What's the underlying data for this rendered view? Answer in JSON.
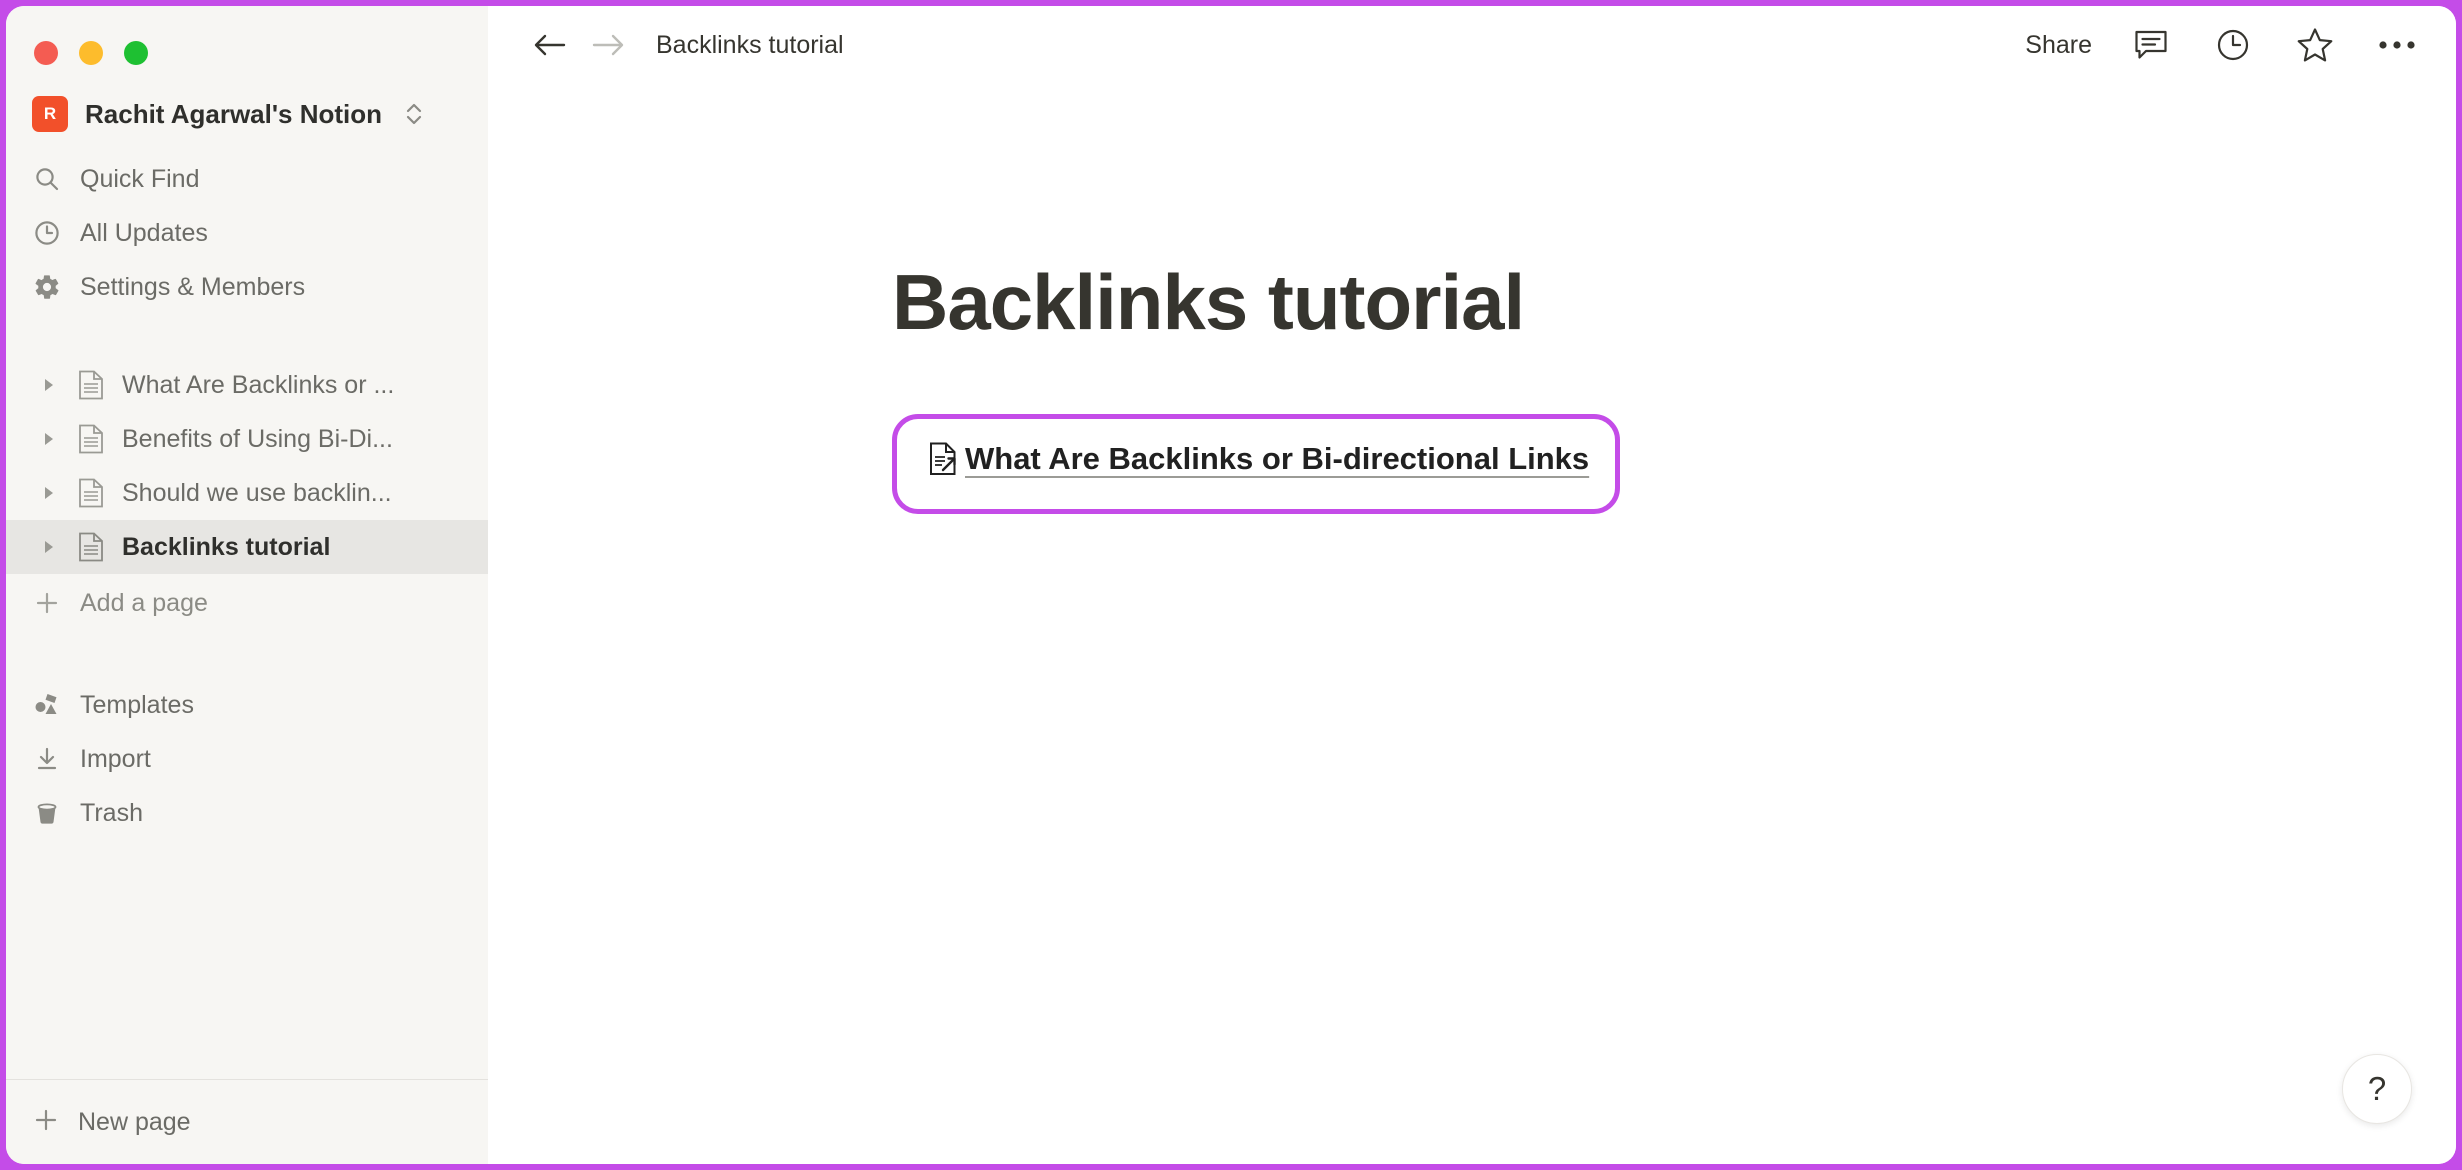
{
  "window": {
    "accent_border_color": "#c44ce8",
    "traffic_lights": [
      {
        "name": "close",
        "color": "#f45c52"
      },
      {
        "name": "minimize",
        "color": "#fdbc2c"
      },
      {
        "name": "maximize",
        "color": "#1ec032"
      }
    ]
  },
  "sidebar": {
    "workspace": {
      "avatar_letter": "R",
      "avatar_color": "#f2502a",
      "name": "Rachit Agarwal's Notion",
      "chevron_icon": "chevron-up-down-icon"
    },
    "nav_items": [
      {
        "icon": "search-icon",
        "label": "Quick Find"
      },
      {
        "icon": "clock-icon",
        "label": "All Updates"
      },
      {
        "icon": "gear-icon",
        "label": "Settings & Members"
      }
    ],
    "pages": [
      {
        "icon": "page-icon",
        "caret": "caret-right-icon",
        "label": "What Are Backlinks or ...",
        "selected": false
      },
      {
        "icon": "page-icon",
        "caret": "caret-right-icon",
        "label": "Benefits of Using Bi-Di...",
        "selected": false
      },
      {
        "icon": "page-icon",
        "caret": "caret-right-icon",
        "label": "Should we use backlin...",
        "selected": false
      },
      {
        "icon": "page-icon",
        "caret": "caret-right-icon",
        "label": "Backlinks tutorial",
        "selected": true
      }
    ],
    "add_page": {
      "icon": "plus-icon",
      "label": "Add a page"
    },
    "tools": [
      {
        "icon": "templates-icon",
        "label": "Templates"
      },
      {
        "icon": "import-icon",
        "label": "Import"
      },
      {
        "icon": "trash-icon",
        "label": "Trash"
      }
    ],
    "new_page": {
      "icon": "plus-icon",
      "label": "New page"
    }
  },
  "topbar": {
    "back_icon": "arrow-left-icon",
    "forward_icon": "arrow-right-icon",
    "breadcrumb": "Backlinks tutorial",
    "share_label": "Share",
    "comment_icon": "comment-icon",
    "history_icon": "clock-icon",
    "favorite_icon": "star-icon",
    "more_icon": "ellipsis-icon"
  },
  "page": {
    "title": "Backlinks tutorial",
    "link_block": {
      "icon": "page-external-link-icon",
      "text": "What Are Backlinks or Bi-directional Links",
      "highlight_color": "#c44ce8"
    }
  },
  "help": {
    "label": "?"
  }
}
